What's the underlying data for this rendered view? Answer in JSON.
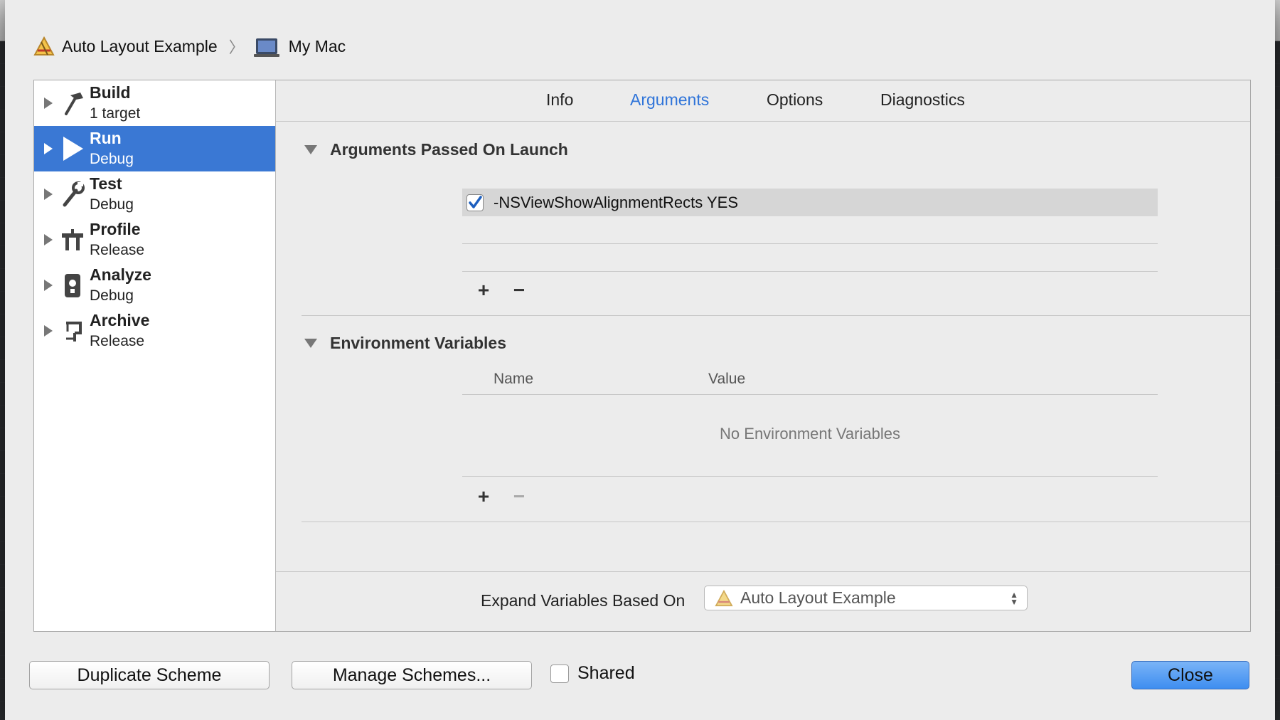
{
  "breadcrumb": {
    "project": "Auto Layout Example",
    "destination": "My Mac"
  },
  "sidebar": {
    "items": [
      {
        "title": "Build",
        "subtitle": "1 target",
        "icon": "hammer-icon"
      },
      {
        "title": "Run",
        "subtitle": "Debug",
        "icon": "play-icon"
      },
      {
        "title": "Test",
        "subtitle": "Debug",
        "icon": "wrench-icon"
      },
      {
        "title": "Profile",
        "subtitle": "Release",
        "icon": "instruments-icon"
      },
      {
        "title": "Analyze",
        "subtitle": "Debug",
        "icon": "analyze-icon"
      },
      {
        "title": "Archive",
        "subtitle": "Release",
        "icon": "archive-icon"
      }
    ],
    "selected": "Run"
  },
  "tabs": {
    "items": [
      "Info",
      "Arguments",
      "Options",
      "Diagnostics"
    ],
    "active": "Arguments"
  },
  "arguments": {
    "header": "Arguments Passed On Launch",
    "rows": [
      {
        "enabled": true,
        "value": "-NSViewShowAlignmentRects YES"
      }
    ],
    "add_label": "+",
    "remove_label": "−"
  },
  "environment": {
    "header": "Environment Variables",
    "columns": [
      "Name",
      "Value"
    ],
    "empty_message": "No Environment Variables",
    "add_label": "+",
    "remove_label": "−"
  },
  "expand": {
    "label": "Expand Variables Based On",
    "selected": "Auto Layout Example"
  },
  "buttons": {
    "duplicate": "Duplicate Scheme",
    "manage": "Manage Schemes...",
    "shared": "Shared",
    "close": "Close"
  },
  "colors": {
    "selection": "#3a78d4",
    "active_tab": "#2f74d9",
    "close_button": "#4a95f2"
  }
}
